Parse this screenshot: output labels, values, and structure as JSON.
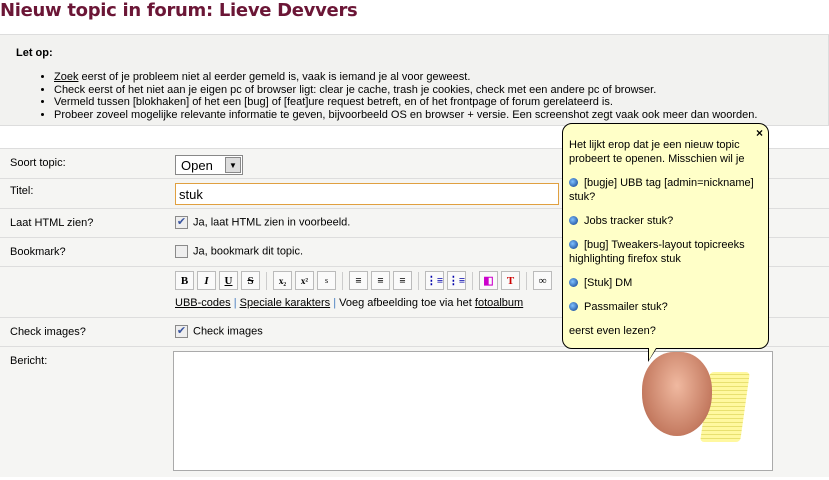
{
  "title": "Nieuw topic in forum: Lieve Devvers",
  "notice": {
    "heading": "Let op:",
    "items": [
      {
        "link": "Zoek",
        "text": " eerst of je probleem niet al eerder gemeld is, vaak is iemand je al voor geweest."
      },
      {
        "text": "Check eerst of het niet aan je eigen pc of browser ligt: clear je cache, trash je cookies, check met een andere pc of browser."
      },
      {
        "text": "Vermeld tussen [blokhaken] of het een [bug] of [feat]ure request betreft, en of het frontpage of forum gerelateerd is."
      },
      {
        "text": "Probeer zoveel mogelijke relevante informatie te geven, bijvoorbeeld OS en browser + versie. Een screenshot zegt vaak ook meer dan woorden."
      }
    ]
  },
  "form": {
    "soort_label": "Soort topic:",
    "soort_value": "Open",
    "titel_label": "Titel:",
    "titel_value": "stuk",
    "html_label": "Laat HTML zien?",
    "html_text": "Ja, laat HTML zien in voorbeeld.",
    "html_checked": true,
    "bookmark_label": "Bookmark?",
    "bookmark_text": "Ja, bookmark dit topic.",
    "bookmark_checked": false,
    "toolbar": [
      "B",
      "I",
      "U",
      "S",
      "x₂",
      "x²",
      "s"
    ],
    "ubb": "UBB-codes",
    "special": "Speciale karakters",
    "img_text": " Voeg afbeelding toe via het ",
    "fotoalbum": "fotoalbum",
    "sep": "|",
    "check_label": "Check images?",
    "check_text": "Check images",
    "check_checked": true,
    "bericht_label": "Bericht:"
  },
  "tooltip": {
    "intro": "Het lijkt erop dat je een nieuw topic probeert te openen. Misschien wil je",
    "close": "×",
    "items": [
      "[bugje] UBB tag [admin=nickname] stuk?",
      "Jobs tracker stuk?",
      "[bug] Tweakers-layout topicreeks highlighting firefox stuk",
      "[Stuk] DM",
      "Passmailer stuk?"
    ],
    "outro": "eerst even lezen?"
  }
}
